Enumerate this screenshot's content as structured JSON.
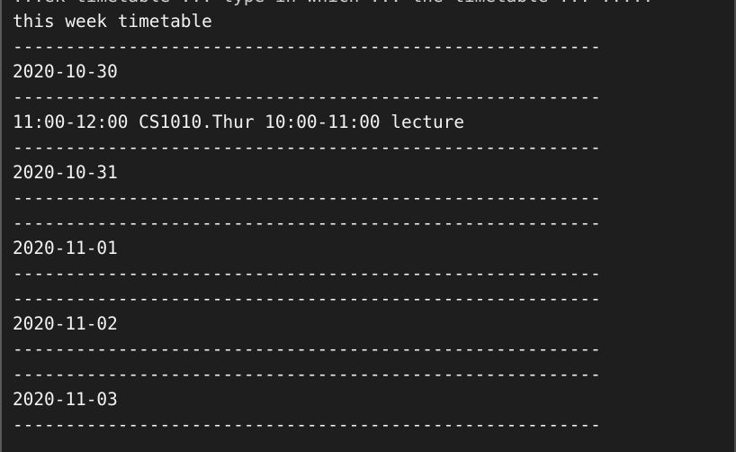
{
  "terminal": {
    "lines": [
      "...ek timetable ... type in which ... the timetable ... .....",
      "this week timetable",
      "--------------------------------------------------------",
      "2020-10-30",
      "--------------------------------------------------------",
      "11:00-12:00 CS1010.Thur 10:00-11:00 lecture",
      "--------------------------------------------------------",
      "2020-10-31",
      "--------------------------------------------------------",
      "--------------------------------------------------------",
      "2020-11-01",
      "--------------------------------------------------------",
      "--------------------------------------------------------",
      "2020-11-02",
      "--------------------------------------------------------",
      "--------------------------------------------------------",
      "2020-11-03",
      "--------------------------------------------------------"
    ]
  }
}
